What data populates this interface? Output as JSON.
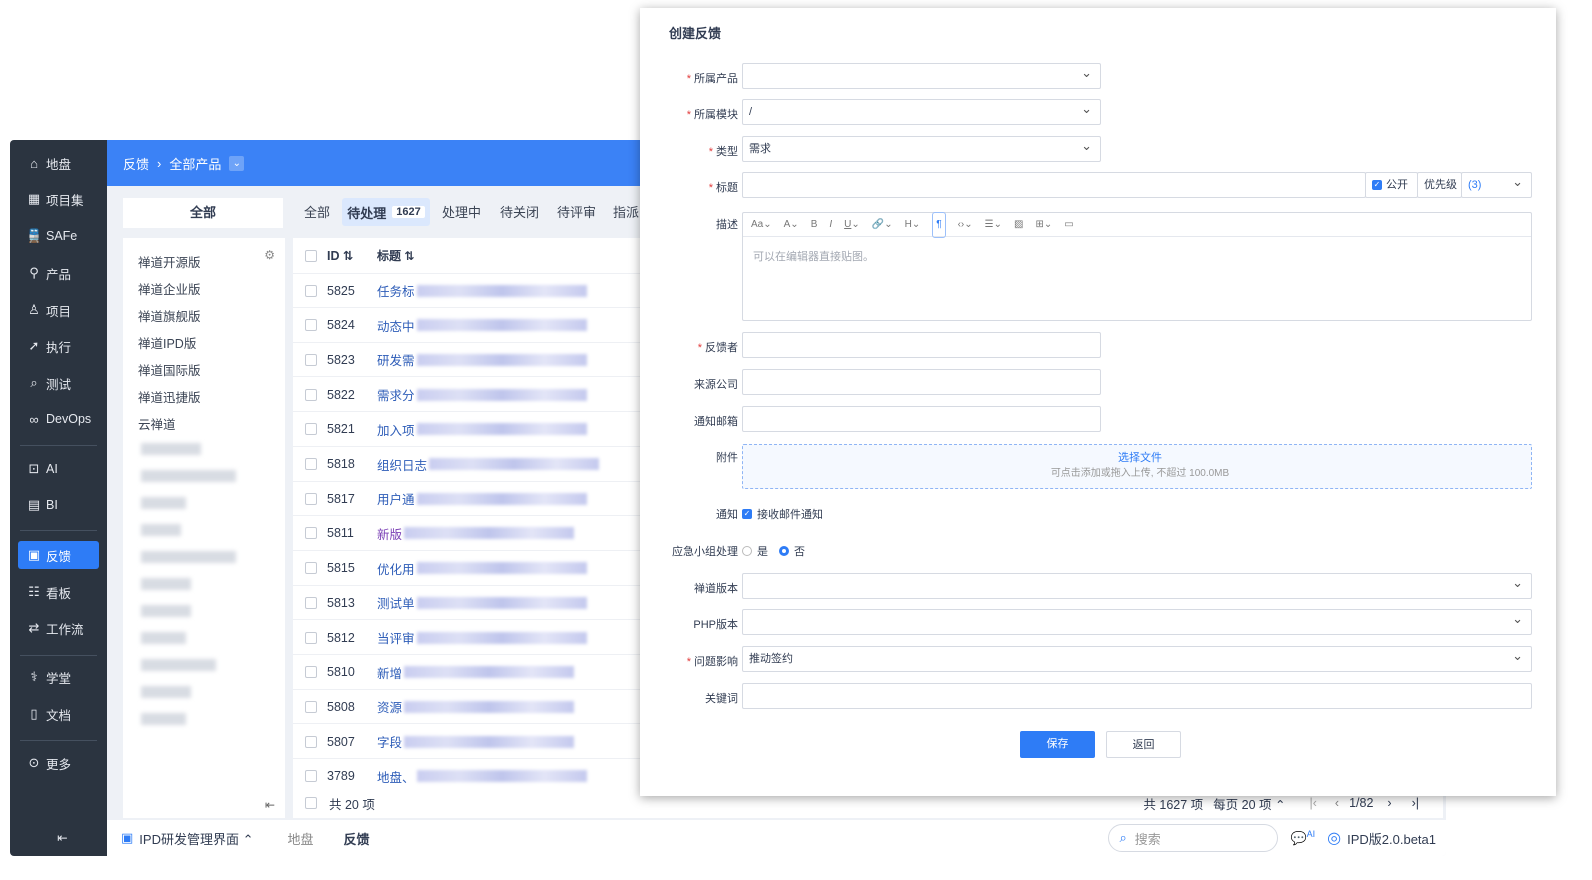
{
  "sidebar": {
    "items": [
      {
        "label": "地盘",
        "icon": "home-icon"
      },
      {
        "label": "项目集",
        "icon": "grid-icon"
      },
      {
        "label": "SAFe",
        "icon": "train-icon"
      },
      {
        "label": "产品",
        "icon": "location-icon"
      },
      {
        "label": "项目",
        "icon": "rocket-icon"
      },
      {
        "label": "执行",
        "icon": "run-icon"
      },
      {
        "label": "测试",
        "icon": "search-icon"
      },
      {
        "label": "DevOps",
        "icon": "infinity-icon"
      },
      {
        "label": "AI",
        "icon": "robot-icon"
      },
      {
        "label": "BI",
        "icon": "chart-icon"
      },
      {
        "label": "反馈",
        "icon": "feedback-icon"
      },
      {
        "label": "看板",
        "icon": "board-icon"
      },
      {
        "label": "工作流",
        "icon": "workflow-icon"
      },
      {
        "label": "学堂",
        "icon": "school-icon"
      },
      {
        "label": "文档",
        "icon": "doc-icon"
      },
      {
        "label": "更多",
        "icon": "more-icon"
      }
    ]
  },
  "header": {
    "module": "反馈",
    "product": "全部产品"
  },
  "tabs": {
    "all_left": "全部",
    "items": [
      "全部",
      "待处理",
      "处理中",
      "待关闭",
      "待评审",
      "指派"
    ],
    "active_count": "1627"
  },
  "products": [
    "禅道开源版",
    "禅道企业版",
    "禅道旗舰版",
    "禅道IPD版",
    "禅道国际版",
    "禅道迅捷版",
    "云禅道"
  ],
  "table": {
    "col_id": "ID",
    "col_title": "标题",
    "rows": [
      {
        "id": "5825",
        "t": "任务标"
      },
      {
        "id": "5824",
        "t": "动态中"
      },
      {
        "id": "5823",
        "t": "研发需"
      },
      {
        "id": "5822",
        "t": "需求分"
      },
      {
        "id": "5821",
        "t": "加入项"
      },
      {
        "id": "5818",
        "t": "组织日志"
      },
      {
        "id": "5817",
        "t": "用户通"
      },
      {
        "id": "5811",
        "t": "新版"
      },
      {
        "id": "5815",
        "t": "优化用"
      },
      {
        "id": "5813",
        "t": "测试单"
      },
      {
        "id": "5812",
        "t": "当评审"
      },
      {
        "id": "5810",
        "t": "新增"
      },
      {
        "id": "5808",
        "t": "资源"
      },
      {
        "id": "5807",
        "t": "字段"
      },
      {
        "id": "3789",
        "t": "地盘、"
      }
    ],
    "footer": "共 20 项"
  },
  "pager": {
    "total": "共 1627 项",
    "per_page": "每页 20 项",
    "page": "1/82"
  },
  "bottom": {
    "app": "IPD研发管理界面",
    "crumb1": "地盘",
    "crumb2": "反馈",
    "search_placeholder": "搜索",
    "version": "IPD版2.0.beta1",
    "ai": "AI"
  },
  "form": {
    "title": "创建反馈",
    "product_label": "所属产品",
    "module_label": "所属模块",
    "module_value": "/",
    "type_label": "类型",
    "type_value": "需求",
    "title_label": "标题",
    "public_label": "公开",
    "priority_label": "优先级",
    "priority_value": "3",
    "desc_label": "描述",
    "desc_placeholder": "可以在编辑器直接贴图。",
    "feedbacker_label": "反馈者",
    "company_label": "来源公司",
    "email_label": "通知邮箱",
    "attach_label": "附件",
    "attach_button": "选择文件",
    "attach_hint": "可点击添加或拖入上传, 不超过 100.0MB",
    "notify_label": "通知",
    "notify_option": "接收邮件通知",
    "emergency_label": "应急小组处理",
    "yes": "是",
    "no": "否",
    "zentao_ver_label": "禅道版本",
    "php_ver_label": "PHP版本",
    "impact_label": "问题影响",
    "impact_value": "推动签约",
    "keywords_label": "关键词",
    "save": "保存",
    "back": "返回"
  },
  "colors": {
    "primary": "#2e7cf6",
    "sidebar": "#2b3440",
    "header": "#3b82f6"
  }
}
